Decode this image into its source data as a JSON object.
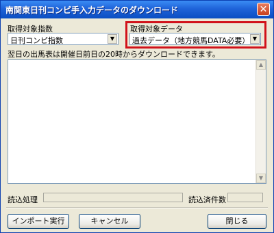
{
  "window": {
    "title": "南関東日刊コンピ手入力データのダウンロード"
  },
  "left_group": {
    "label": "取得対象指数",
    "selected": "日刊コンピ指数"
  },
  "right_group": {
    "label": "取得対象データ",
    "selected": "過去データ（地方競馬DATA必要）"
  },
  "note": "翌日の出馬表は開催日前日の20時からダウンロードできます。",
  "status": {
    "read_label": "読込処理",
    "count_label": "読込済件数"
  },
  "buttons": {
    "import": "インポート実行",
    "cancel": "キャンセル",
    "close": "閉じる"
  }
}
